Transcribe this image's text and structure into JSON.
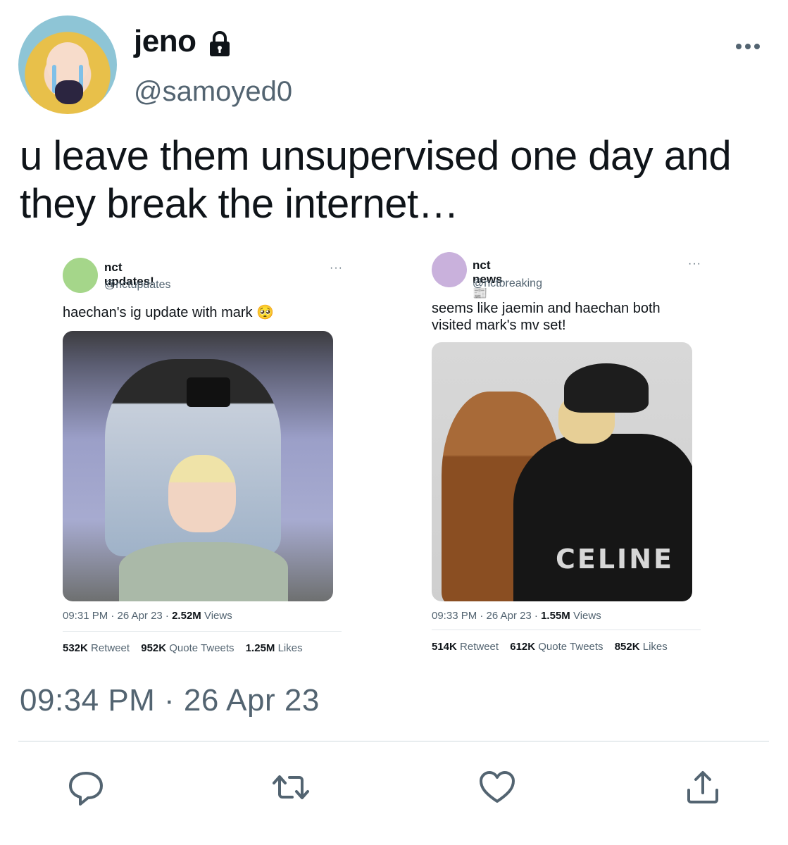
{
  "tweet": {
    "author": {
      "display_name": "jeno",
      "handle": "@samoyed0",
      "locked": true
    },
    "text": "u leave them unsupervised one day and they break the internet…",
    "timestamp": "09:34 PM · 26 Apr 23"
  },
  "embedded": [
    {
      "name": "nct updates!",
      "handle": "@nctupdates",
      "avatar_color": "#a5d68a",
      "text": "haechan's ig update with mark 🥺",
      "time": "09:31 PM · 26 Apr 23 · ",
      "views_count": "2.52M",
      "views_label": " Views",
      "retweets": "532K",
      "retweets_label": "Retweet",
      "quotes": "952K",
      "quotes_label": "Quote Tweets",
      "likes": "1.25M",
      "likes_label": "Likes"
    },
    {
      "name": "nct news 📰",
      "handle": "@nctbreaking",
      "avatar_color": "#c9b1dc",
      "text": "seems like jaemin and haechan both visited mark's mv set!",
      "photo_text": "CELINE",
      "time": "09:33 PM · 26 Apr 23 · ",
      "views_count": "1.55M",
      "views_label": " Views",
      "retweets": "514K",
      "retweets_label": "Retweet",
      "quotes": "612K",
      "quotes_label": "Quote Tweets",
      "likes": "852K",
      "likes_label": "Likes"
    }
  ],
  "actions": [
    "reply-icon",
    "retweet-icon",
    "like-icon",
    "share-icon"
  ],
  "colors": {
    "secondary_text": "#536471",
    "primary_text": "#0f1419",
    "divider": "#cfd9de"
  }
}
